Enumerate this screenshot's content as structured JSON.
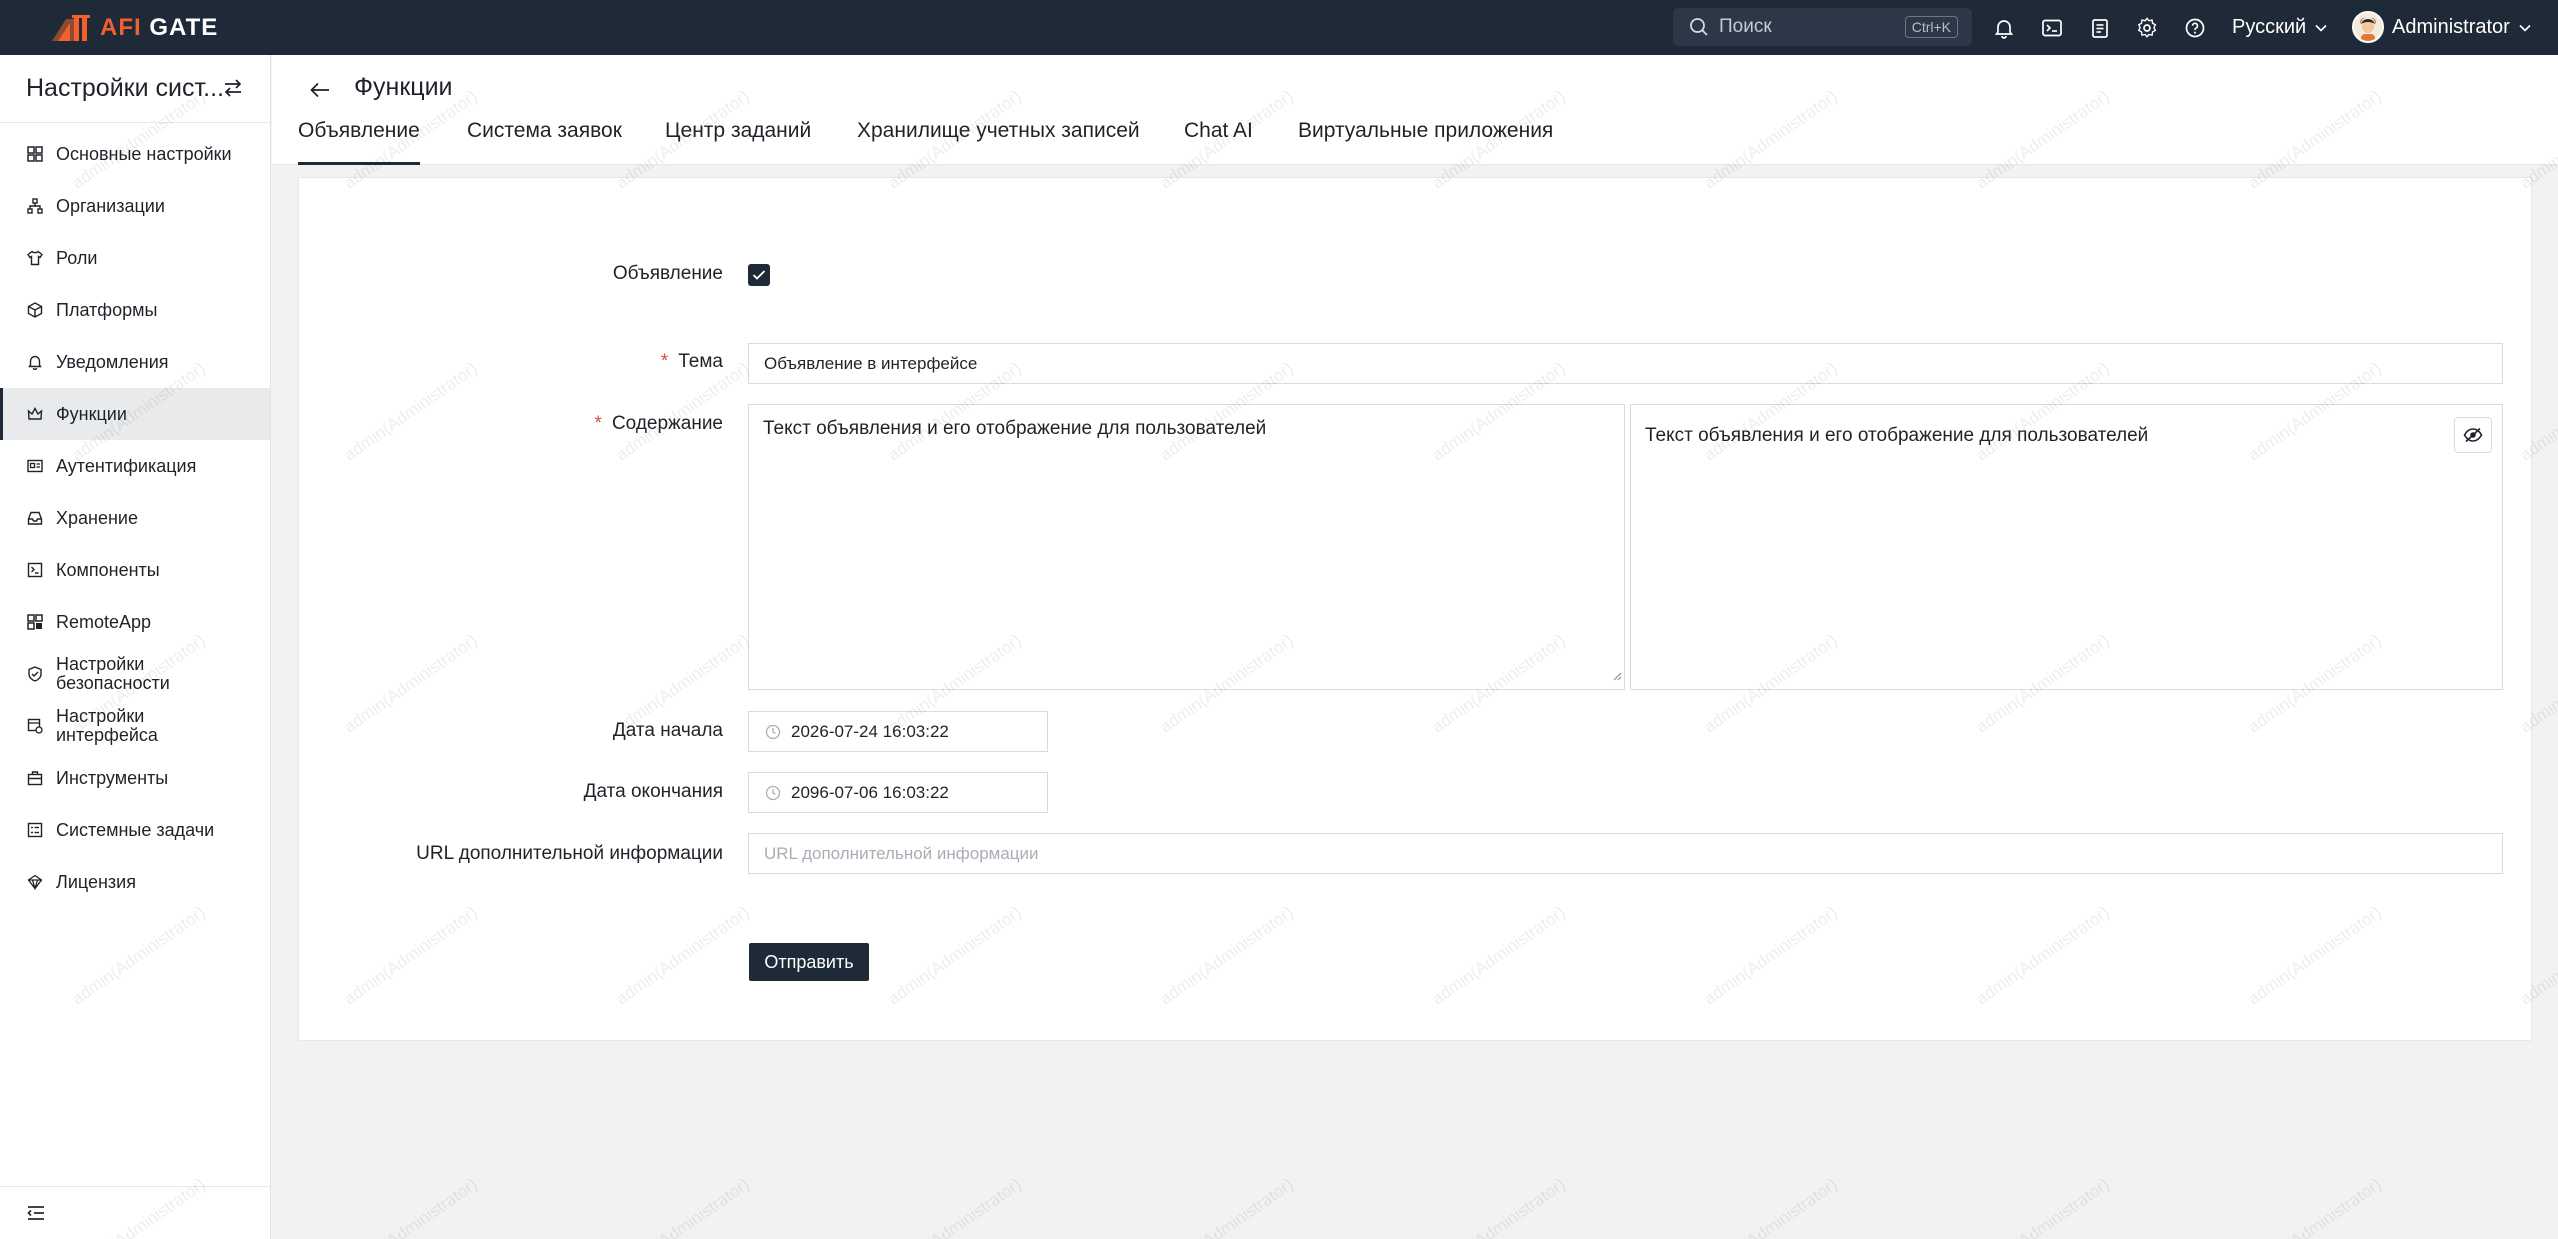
{
  "app": {
    "logo_text_a": "AFI",
    "logo_text_b": "GATE",
    "brand_color": "#f1602d",
    "header_bg": "#1e2a38"
  },
  "topbar": {
    "search_placeholder": "Поиск",
    "search_shortcut": "Ctrl+K",
    "icons": [
      "bell-icon",
      "terminal-icon",
      "clipboard-icon",
      "gear-icon",
      "help-icon"
    ],
    "language": "Русский",
    "user_name": "Administrator"
  },
  "sidebar": {
    "title": "Настройки сист...",
    "items": [
      {
        "label": "Основные настройки",
        "icon": "grid-icon"
      },
      {
        "label": "Организации",
        "icon": "org-tree-icon"
      },
      {
        "label": "Роли",
        "icon": "shirt-icon"
      },
      {
        "label": "Платформы",
        "icon": "cube-icon"
      },
      {
        "label": "Уведомления",
        "icon": "bell-icon"
      },
      {
        "label": "Функции",
        "icon": "crown-icon",
        "active": true
      },
      {
        "label": "Аутентификация",
        "icon": "id-card-icon"
      },
      {
        "label": "Хранение",
        "icon": "inbox-icon"
      },
      {
        "label": "Компоненты",
        "icon": "component-icon"
      },
      {
        "label": "RemoteApp",
        "icon": "apps-icon"
      },
      {
        "label_line1": "Настройки",
        "label_line2": "безопасности",
        "icon": "shield-check-icon"
      },
      {
        "label_line1": "Настройки",
        "label_line2": "интерфейса",
        "icon": "interface-icon"
      },
      {
        "label": "Инструменты",
        "icon": "toolbox-icon"
      },
      {
        "label": "Системные задачи",
        "icon": "task-list-icon"
      },
      {
        "label": "Лицензия",
        "icon": "license-icon"
      }
    ]
  },
  "page": {
    "title": "Функции",
    "tabs": [
      {
        "label": "Объявление",
        "active": true
      },
      {
        "label": "Система заявок"
      },
      {
        "label": "Центр заданий"
      },
      {
        "label": "Хранилище учетных записей"
      },
      {
        "label": "Chat AI"
      },
      {
        "label": "Виртуальные приложения"
      }
    ]
  },
  "form": {
    "announcement_label": "Объявление",
    "announcement_enabled": true,
    "subject_label": "Тема",
    "subject_value": "Объявление в интерфейсе",
    "content_label": "Содержание",
    "content_value": "Текст объявления и его отображение для пользователей",
    "content_preview": "Текст объявления и его отображение для пользователей",
    "start_label": "Дата начала",
    "start_value": "2026-07-24 16:03:22",
    "end_label": "Дата окончания",
    "end_value": "2096-07-06 16:03:22",
    "url_label": "URL дополнительной информации",
    "url_placeholder": "URL дополнительной информации",
    "submit_label": "Отправить"
  },
  "watermark": "admin(Administrator)"
}
